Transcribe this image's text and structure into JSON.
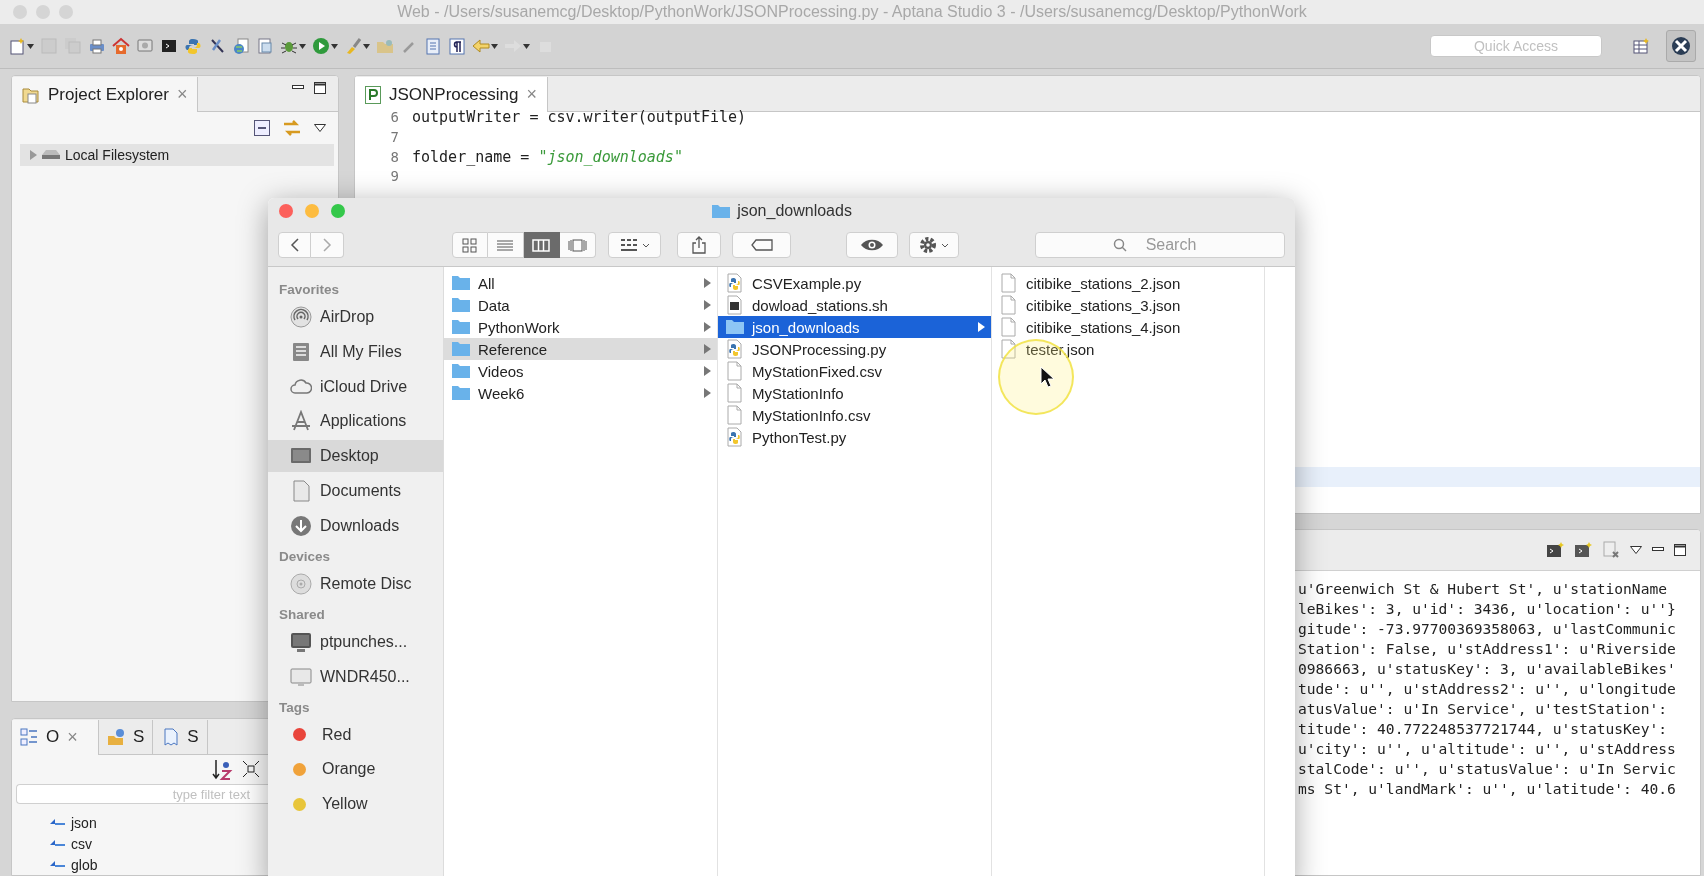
{
  "window": {
    "title": "Web - /Users/susanemcg/Desktop/PythonWork/JSONProcessing.py - Aptana Studio 3 - /Users/susanemcg/Desktop/PythonWork"
  },
  "toolbar": {
    "quick_access": {
      "placeholder": "Quick Access"
    }
  },
  "project_explorer": {
    "tab": {
      "label": "Project Explorer",
      "close": "×",
      "selected": true
    },
    "tree": [
      {
        "label": "Local Filesystem",
        "expanded": false,
        "selected": true
      }
    ]
  },
  "editor": {
    "tab": {
      "label": "JSONProcessing",
      "close": "×",
      "selected": true
    },
    "lines": [
      {
        "number": "6",
        "tokens": [
          {
            "text": "outputWriter = csv.writer(outputFile)",
            "kind": "plain"
          }
        ]
      },
      {
        "number": "7"
      },
      {
        "number": "8",
        "tokens": [
          {
            "text": "folder_name = ",
            "kind": "plain"
          },
          {
            "text": "\"json_downloads\"",
            "kind": "string"
          }
        ]
      },
      {
        "number": "9"
      }
    ]
  },
  "console": {
    "lines": [
      "u'Greenwich St & Hubert St', u'stationName",
      "leBikes': 3, u'id': 3436, u'location': u''}",
      "gitude': -73.97700369358063, u'lastCommunic",
      "Station': False, u'stAddress1': u'Riverside",
      "0986663, u'statusKey': 3, u'availableBikes'",
      "tude': u'', u'stAddress2': u'', u'longitude",
      "atusValue': u'In Service', u'testStation':",
      "titude': 40.772248537721744, u'statusKey':",
      "u'city': u'', u'altitude': u'', u'stAddress",
      "stalCode': u'', u'statusValue': u'In Servic",
      "ms St', u'landMark': u'', u'latitude': 40.6"
    ]
  },
  "outline": {
    "tabs": [
      {
        "label": "O",
        "close": "×",
        "selected": true
      },
      {
        "label": "S",
        "selected": false
      },
      {
        "label": "S",
        "selected": false
      }
    ],
    "filter": {
      "placeholder": "type filter text"
    },
    "items": [
      "json",
      "csv",
      "glob"
    ]
  },
  "finder": {
    "title": "json_downloads",
    "views": [
      {
        "kind": "icon",
        "selected": false
      },
      {
        "kind": "list",
        "selected": false
      },
      {
        "kind": "column",
        "selected": true
      },
      {
        "kind": "coverflow",
        "selected": false
      }
    ],
    "search": {
      "placeholder": "Search"
    },
    "sidebar": [
      {
        "heading": "Favorites",
        "items": [
          {
            "label": "AirDrop",
            "kind": "airdrop",
            "selected": false
          },
          {
            "label": "All My Files",
            "kind": "files",
            "selected": false
          },
          {
            "label": "iCloud Drive",
            "kind": "cloud",
            "selected": false
          },
          {
            "label": "Applications",
            "kind": "apps",
            "selected": false
          },
          {
            "label": "Desktop",
            "kind": "desktop",
            "selected": true
          },
          {
            "label": "Documents",
            "kind": "documents",
            "selected": false
          },
          {
            "label": "Downloads",
            "kind": "downloads",
            "selected": false
          }
        ]
      },
      {
        "heading": "Devices",
        "items": [
          {
            "label": "Remote Disc",
            "kind": "disc",
            "selected": false
          }
        ]
      },
      {
        "heading": "Shared",
        "items": [
          {
            "label": "ptpunches...",
            "kind": "server",
            "selected": false
          },
          {
            "label": "WNDR450...",
            "kind": "computer",
            "selected": false
          }
        ]
      },
      {
        "heading": "Tags",
        "items": [
          {
            "label": "Red",
            "kind": "tag",
            "color": "#e9453b",
            "selected": false
          },
          {
            "label": "Orange",
            "kind": "tag",
            "color": "#f0a23a",
            "selected": false
          },
          {
            "label": "Yellow",
            "kind": "tag",
            "color": "#e8c53a",
            "selected": false
          }
        ]
      }
    ],
    "columns": [
      {
        "items": [
          {
            "label": "All",
            "kind": "folder",
            "has_children": true,
            "selected": false
          },
          {
            "label": "Data",
            "kind": "folder",
            "has_children": true,
            "selected": false
          },
          {
            "label": "PythonWork",
            "kind": "folder",
            "has_children": true,
            "selected": false
          },
          {
            "label": "Reference",
            "kind": "folder",
            "has_children": true,
            "selected": true
          },
          {
            "label": "Videos",
            "kind": "folder",
            "has_children": true,
            "selected": false
          },
          {
            "label": "Week6",
            "kind": "folder",
            "has_children": true,
            "selected": false
          }
        ]
      },
      {
        "items": [
          {
            "label": "CSVExample.py",
            "kind": "python",
            "has_children": false,
            "selected": false
          },
          {
            "label": "dowload_stations.sh",
            "kind": "script",
            "has_children": false,
            "selected": false
          },
          {
            "label": "json_downloads",
            "kind": "folder",
            "has_children": true,
            "selected": true
          },
          {
            "label": "JSONProcessing.py",
            "kind": "python",
            "has_children": false,
            "selected": false
          },
          {
            "label": "MyStationFixed.csv",
            "kind": "document",
            "has_children": false,
            "selected": false
          },
          {
            "label": "MyStationInfo",
            "kind": "document",
            "has_children": false,
            "selected": false
          },
          {
            "label": "MyStationInfo.csv",
            "kind": "document",
            "has_children": false,
            "selected": false
          },
          {
            "label": "PythonTest.py",
            "kind": "python",
            "has_children": false,
            "selected": false
          }
        ]
      },
      {
        "items": [
          {
            "label": "citibike_stations_2.json",
            "kind": "document",
            "has_children": false,
            "selected": false
          },
          {
            "label": "citibike_stations_3.json",
            "kind": "document",
            "has_children": false,
            "selected": false
          },
          {
            "label": "citibike_stations_4.json",
            "kind": "document",
            "has_children": false,
            "selected": false
          },
          {
            "label": "tester.json",
            "kind": "document",
            "has_children": false,
            "selected": false
          }
        ]
      }
    ]
  }
}
